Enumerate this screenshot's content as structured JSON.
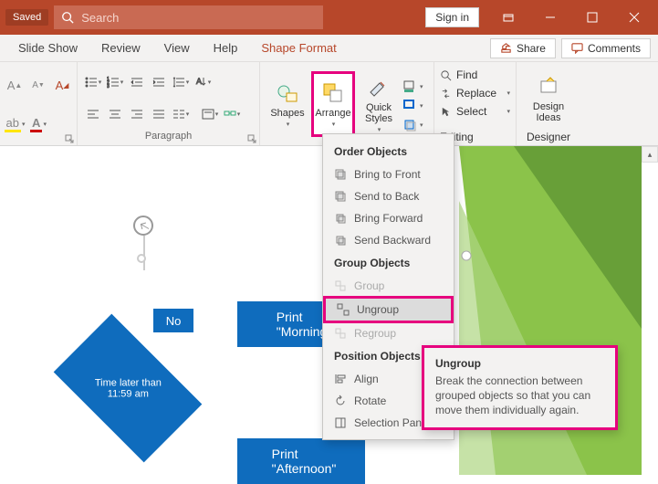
{
  "titlebar": {
    "autosave": "Saved",
    "search_placeholder": "Search",
    "signin": "Sign in"
  },
  "tabs": {
    "slideshow": "Slide Show",
    "review": "Review",
    "view": "View",
    "help": "Help",
    "shape_format": "Shape Format",
    "share": "Share",
    "comments": "Comments"
  },
  "ribbon": {
    "paragraph_label": "Paragraph",
    "shapes": "Shapes",
    "arrange": "Arrange",
    "quick_styles": "Quick\nStyles",
    "find": "Find",
    "replace": "Replace",
    "select": "Select",
    "editing_label": "Editing",
    "design_ideas": "Design\nIdeas",
    "designer_label": "Designer"
  },
  "dropdown": {
    "order_header": "Order Objects",
    "bring_front": "Bring to Front",
    "send_back": "Send to Back",
    "bring_forward": "Bring Forward",
    "send_backward": "Send Backward",
    "group_header": "Group Objects",
    "group": "Group",
    "ungroup": "Ungroup",
    "regroup": "Regroup",
    "position_header": "Position Objects",
    "align": "Align",
    "rotate": "Rotate",
    "selection_pane": "Selection Pane..."
  },
  "tooltip": {
    "title": "Ungroup",
    "body": "Break the connection between grouped objects so that you can move them individually again."
  },
  "slide": {
    "decision": "Time later than\n11:59 am",
    "no": "No",
    "process1": "Print\n\"Morning\"",
    "process2": "Print\n\"Afternoon\""
  }
}
